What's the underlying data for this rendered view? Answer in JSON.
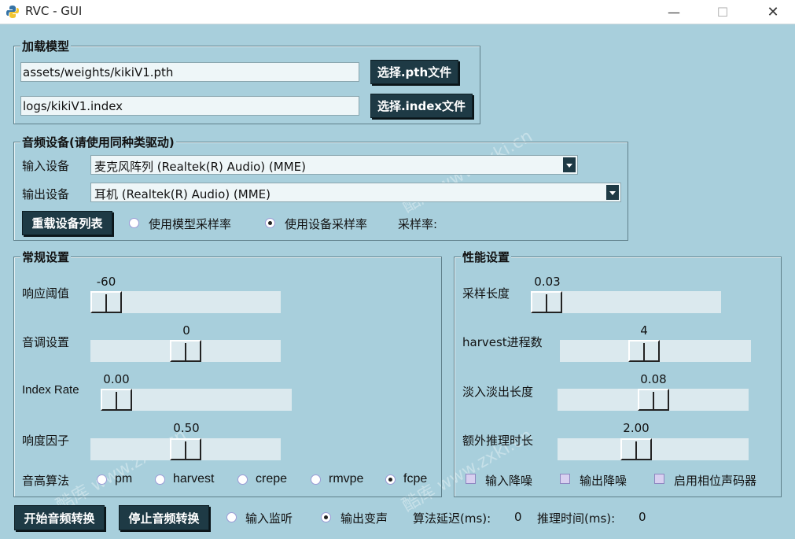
{
  "window": {
    "title": "RVC - GUI",
    "minimize": "—",
    "maximize": "☐",
    "close": "✕"
  },
  "load_model": {
    "legend": "加载模型",
    "pth_path": "assets/weights/kikiV1.pth",
    "index_path": "logs/kikiV1.index",
    "select_pth": "选择.pth文件",
    "select_index": "选择.index文件"
  },
  "audio_device": {
    "legend": "音频设备(请使用同种类驱动)",
    "input_label": "输入设备",
    "input_value": "麦克风阵列 (Realtek(R) Audio) (MME)",
    "output_label": "输出设备",
    "output_value": "耳机 (Realtek(R) Audio) (MME)",
    "reload": "重载设备列表",
    "use_model_sr": "使用模型采样率",
    "use_device_sr": "使用设备采样率",
    "sample_rate_label": "采样率:",
    "selected": "use_device_sr"
  },
  "general": {
    "legend": "常规设置",
    "threshold": {
      "label": "响应阈值",
      "value": "-60",
      "min": -60,
      "max": 0
    },
    "pitch": {
      "label": "音调设置",
      "value": "0",
      "min": -24,
      "max": 24
    },
    "index_rate": {
      "label": "Index Rate",
      "value": "0.00",
      "min": 0,
      "max": 1
    },
    "rms": {
      "label": "响度因子",
      "value": "0.50",
      "min": 0,
      "max": 1
    },
    "algo_label": "音高算法",
    "algos": [
      "pm",
      "harvest",
      "crepe",
      "rmvpe",
      "fcpe"
    ],
    "algo_selected": "fcpe"
  },
  "performance": {
    "legend": "性能设置",
    "block": {
      "label": "采样长度",
      "value": "0.03"
    },
    "harvest": {
      "label": "harvest进程数",
      "value": "4"
    },
    "crossfade": {
      "label": "淡入淡出长度",
      "value": "0.08"
    },
    "extra": {
      "label": "额外推理时长",
      "value": "2.00"
    },
    "input_denoise": "输入降噪",
    "output_denoise": "输出降噪",
    "phase_vocoder": "启用相位声码器"
  },
  "bottom": {
    "start": "开始音频转换",
    "stop": "停止音频转换",
    "input_monitor": "输入监听",
    "output_voice": "输出变声",
    "selected": "output_voice",
    "delay_label": "算法延迟(ms):",
    "delay_value": "0",
    "infer_label": "推理时间(ms):",
    "infer_value": "0"
  },
  "colors": {
    "background": "#a8cfdc",
    "button": "#1e3a45"
  }
}
